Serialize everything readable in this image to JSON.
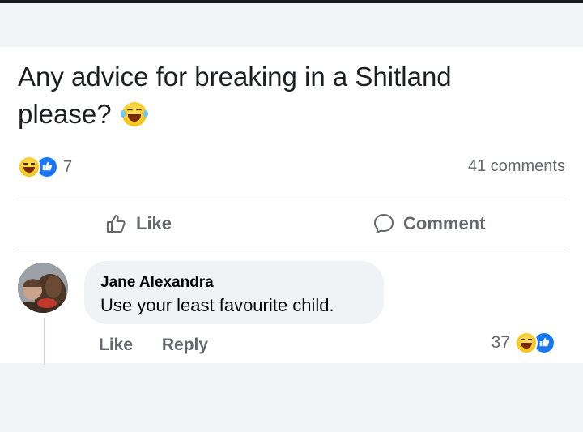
{
  "post": {
    "text": "Any advice for breaking in a Shitland please?",
    "emoji_icon": "laughing-tears-emoji",
    "reaction_count": "7",
    "comments_count": "41 comments"
  },
  "actions": {
    "like_label": "Like",
    "comment_label": "Comment"
  },
  "comment": {
    "author": "Jane Alexandra",
    "text": "Use your least favourite child.",
    "like_label": "Like",
    "reply_label": "Reply",
    "reaction_count": "37"
  },
  "colors": {
    "like_blue": "#1877f2",
    "muted_text": "#65676b",
    "bubble_bg": "#f0f2f5"
  }
}
